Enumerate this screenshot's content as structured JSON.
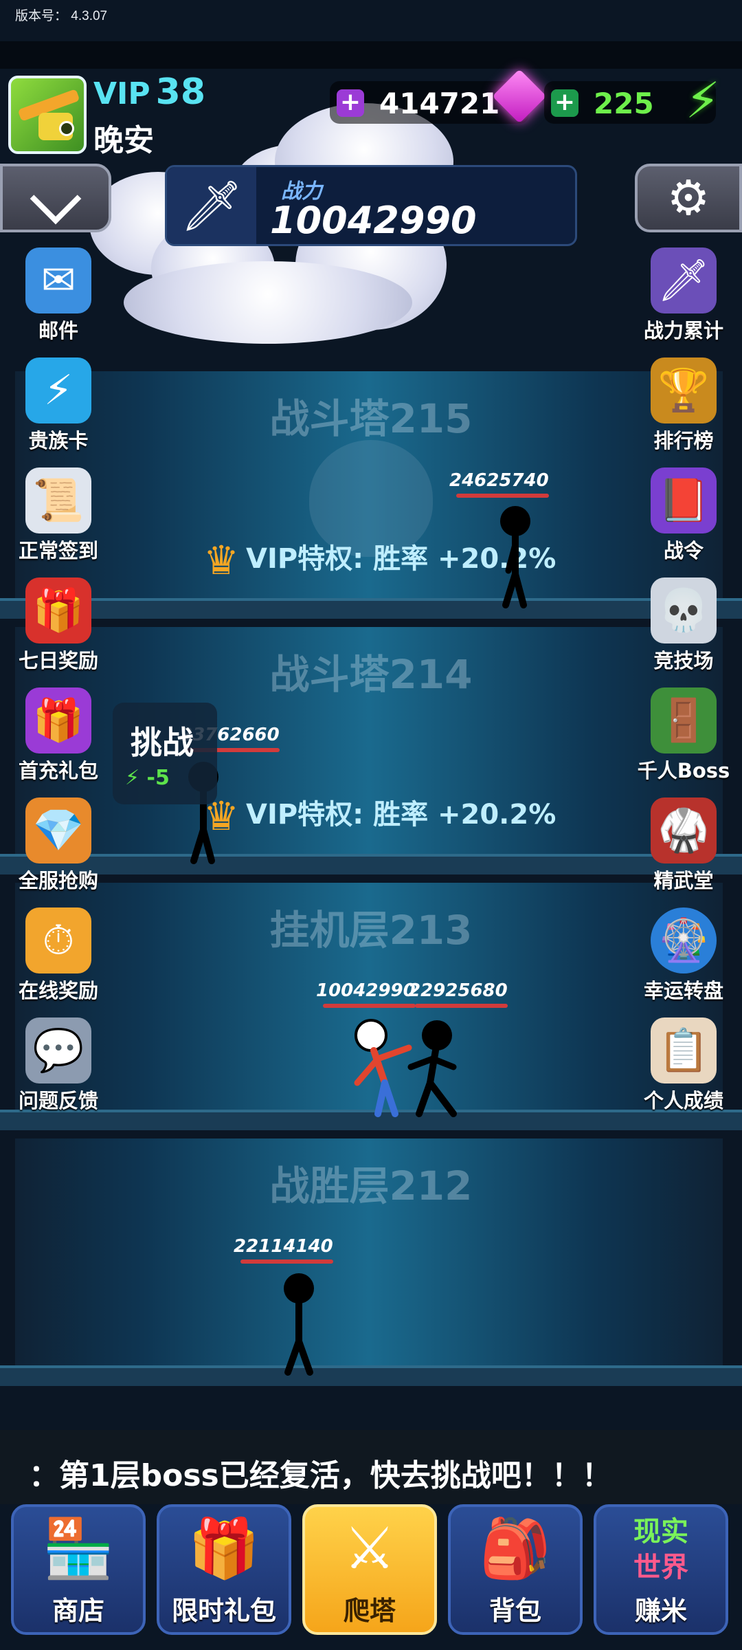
{
  "version": {
    "label": "版本号：",
    "value": "4.3.07"
  },
  "player": {
    "vip_prefix": "VIP",
    "vip_level": "38",
    "name": "晚安"
  },
  "resources": {
    "gems": "414721",
    "energy": "225"
  },
  "power": {
    "label": "战力",
    "value": "10042990"
  },
  "left_menu": [
    "邮件",
    "贵族卡",
    "正常签到",
    "七日奖励",
    "首充礼包",
    "全服抢购",
    "在线奖励",
    "问题反馈"
  ],
  "right_menu": [
    "战力累计",
    "排行榜",
    "战令",
    "竞技场",
    "千人Boss",
    "精武堂",
    "幸运转盘",
    "个人成绩"
  ],
  "floors": [
    {
      "title": "战斗塔215",
      "vip_text": "VIP特权: 胜率 +20.2%",
      "enemy_power": "24625740"
    },
    {
      "title": "战斗塔214",
      "vip_text": "VIP特权: 胜率 +20.2%",
      "enemy_power": "23762660",
      "challenge": "挑战",
      "cost": "-5"
    },
    {
      "title": "挂机层213",
      "player_power": "10042990",
      "enemy_power": "22925680"
    },
    {
      "title": "战胜层212",
      "enemy_power": "22114140"
    }
  ],
  "news": "：第1层boss已经复活，快去挑战吧！！！",
  "nav": [
    "商店",
    "限时礼包",
    "爬塔",
    "背包",
    "赚米"
  ],
  "nav_earn_badge": [
    "现实",
    "世界"
  ],
  "colors": {
    "accent": "#59e3f2",
    "gem": "#e63ae0",
    "energy": "#6ef04b",
    "active_tab": "#f5a51a"
  }
}
